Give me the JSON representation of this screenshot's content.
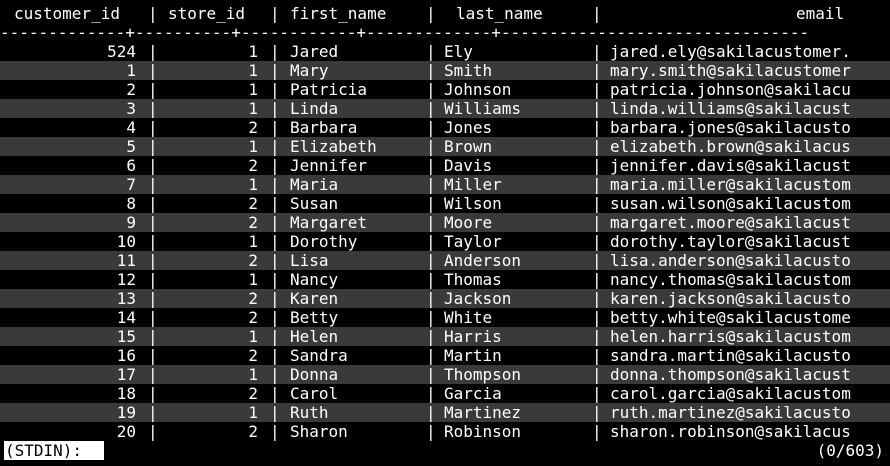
{
  "columns": [
    "customer_id",
    "store_id",
    "first_name",
    "last_name",
    "email"
  ],
  "rule": "-------------+----------+------------+-------------+--------------------------------",
  "rows": [
    {
      "customer_id": "524",
      "store_id": "1",
      "first_name": "Jared",
      "last_name": "Ely",
      "email": "jared.ely@sakilacustomer."
    },
    {
      "customer_id": "1",
      "store_id": "1",
      "first_name": "Mary",
      "last_name": "Smith",
      "email": "mary.smith@sakilacustomer"
    },
    {
      "customer_id": "2",
      "store_id": "1",
      "first_name": "Patricia",
      "last_name": "Johnson",
      "email": "patricia.johnson@sakilacu"
    },
    {
      "customer_id": "3",
      "store_id": "1",
      "first_name": "Linda",
      "last_name": "Williams",
      "email": "linda.williams@sakilacust"
    },
    {
      "customer_id": "4",
      "store_id": "2",
      "first_name": "Barbara",
      "last_name": "Jones",
      "email": "barbara.jones@sakilacusto"
    },
    {
      "customer_id": "5",
      "store_id": "1",
      "first_name": "Elizabeth",
      "last_name": "Brown",
      "email": "elizabeth.brown@sakilacus"
    },
    {
      "customer_id": "6",
      "store_id": "2",
      "first_name": "Jennifer",
      "last_name": "Davis",
      "email": "jennifer.davis@sakilacust"
    },
    {
      "customer_id": "7",
      "store_id": "1",
      "first_name": "Maria",
      "last_name": "Miller",
      "email": "maria.miller@sakilacustom"
    },
    {
      "customer_id": "8",
      "store_id": "2",
      "first_name": "Susan",
      "last_name": "Wilson",
      "email": "susan.wilson@sakilacustom"
    },
    {
      "customer_id": "9",
      "store_id": "2",
      "first_name": "Margaret",
      "last_name": "Moore",
      "email": "margaret.moore@sakilacust"
    },
    {
      "customer_id": "10",
      "store_id": "1",
      "first_name": "Dorothy",
      "last_name": "Taylor",
      "email": "dorothy.taylor@sakilacust"
    },
    {
      "customer_id": "11",
      "store_id": "2",
      "first_name": "Lisa",
      "last_name": "Anderson",
      "email": "lisa.anderson@sakilacusto"
    },
    {
      "customer_id": "12",
      "store_id": "1",
      "first_name": "Nancy",
      "last_name": "Thomas",
      "email": "nancy.thomas@sakilacustom"
    },
    {
      "customer_id": "13",
      "store_id": "2",
      "first_name": "Karen",
      "last_name": "Jackson",
      "email": "karen.jackson@sakilacusto"
    },
    {
      "customer_id": "14",
      "store_id": "2",
      "first_name": "Betty",
      "last_name": "White",
      "email": "betty.white@sakilacustome"
    },
    {
      "customer_id": "15",
      "store_id": "1",
      "first_name": "Helen",
      "last_name": "Harris",
      "email": "helen.harris@sakilacustom"
    },
    {
      "customer_id": "16",
      "store_id": "2",
      "first_name": "Sandra",
      "last_name": "Martin",
      "email": "sandra.martin@sakilacusto"
    },
    {
      "customer_id": "17",
      "store_id": "1",
      "first_name": "Donna",
      "last_name": "Thompson",
      "email": "donna.thompson@sakilacust"
    },
    {
      "customer_id": "18",
      "store_id": "2",
      "first_name": "Carol",
      "last_name": "Garcia",
      "email": "carol.garcia@sakilacustom"
    },
    {
      "customer_id": "19",
      "store_id": "1",
      "first_name": "Ruth",
      "last_name": "Martinez",
      "email": "ruth.martinez@sakilacusto"
    },
    {
      "customer_id": "20",
      "store_id": "2",
      "first_name": "Sharon",
      "last_name": "Robinson",
      "email": "sharon.robinson@sakilacus"
    }
  ],
  "prompt": "(STDIN):",
  "position": "(0/603)",
  "colors": {
    "background": "#000000",
    "text": "#ffffff",
    "stripe": "#3a3a3a",
    "prompt_bg": "#ffffff",
    "prompt_fg": "#000000"
  }
}
